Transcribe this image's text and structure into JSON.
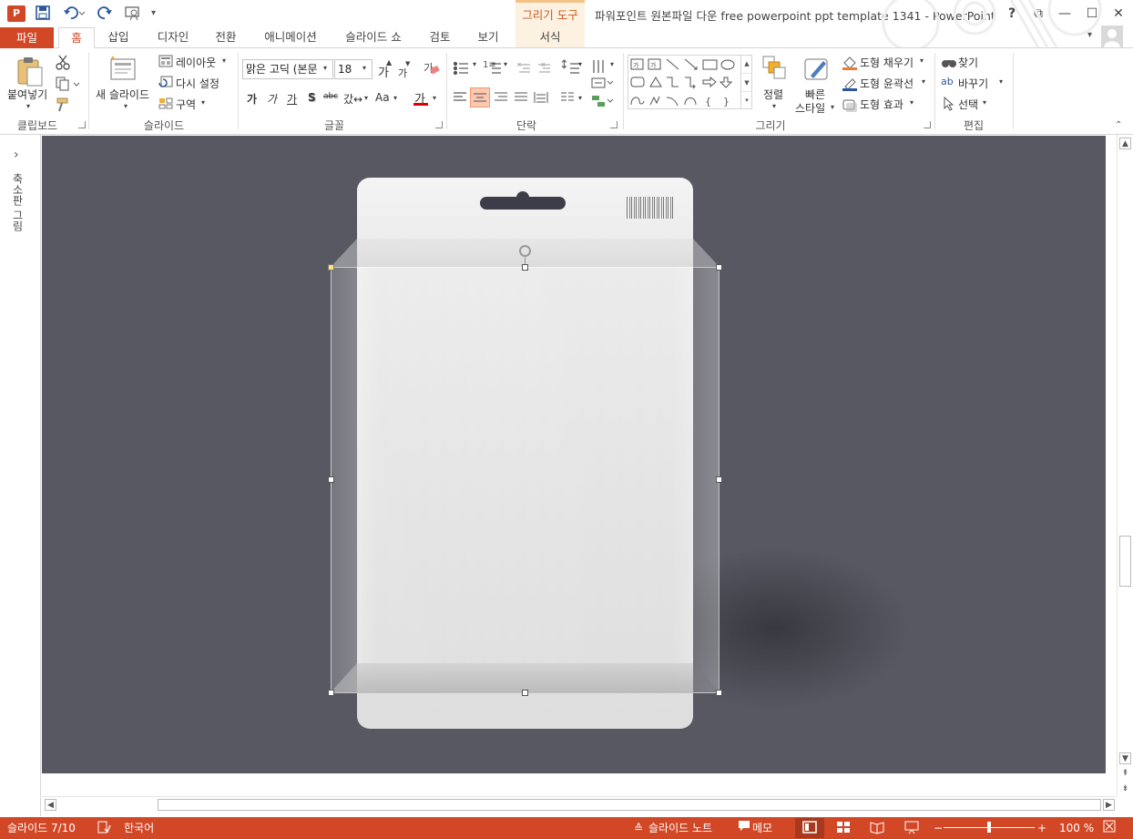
{
  "app": {
    "title": "파워포인트 원본파일 다운 free powerpoint ppt template 1341 - PowerPoint",
    "icon_letter": "P",
    "brand_color": "#d24726"
  },
  "window_controls": {
    "help": "?",
    "restore_ribbon": "⧉",
    "minimize": "—",
    "maximize": "☐",
    "close": "✕"
  },
  "contextual": {
    "label": "그리기 도구"
  },
  "tabs": {
    "file": "파일",
    "home": "홈",
    "insert": "삽입",
    "design": "디자인",
    "transitions": "전환",
    "animations": "애니메이션",
    "slideshow": "슬라이드 쇼",
    "review": "검토",
    "view": "보기",
    "format": "서식"
  },
  "ribbon": {
    "clipboard": {
      "label": "클립보드",
      "paste": "붙여넣기"
    },
    "slides": {
      "label": "슬라이드",
      "new_slide": "새 슬라이드",
      "layout": "레이아웃",
      "reset": "다시 설정",
      "section": "구역"
    },
    "font": {
      "label": "글꼴",
      "font_name": "맑은 고딕 (본문",
      "font_size": "18",
      "grow": "가",
      "shrink": "가",
      "bold": "가",
      "italic": "가",
      "underline": "가",
      "shadow": "S",
      "strike": "abc",
      "spacing": "갔↔",
      "case": "Aa",
      "color": "가"
    },
    "paragraph": {
      "label": "단락"
    },
    "drawing": {
      "label": "그리기",
      "arrange": "정렬",
      "quick_styles": "빠른 스타일",
      "fill": "도형 채우기",
      "outline": "도형 윤곽선",
      "effects": "도형 효과"
    },
    "editing": {
      "label": "편집",
      "find": "찾기",
      "replace": "바꾸기",
      "select": "선택"
    }
  },
  "thumb_pane": {
    "label": "축소판 그림",
    "expand": "›"
  },
  "status": {
    "slide": "슬라이드 7/10",
    "language": "한국어",
    "notes": "슬라이드 노트",
    "comments": "메모",
    "zoom": "100 %",
    "zoom_level": 100
  },
  "colors": {
    "slide_bg": "#585863",
    "status_bar": "#d24726",
    "accent": "#d24726"
  }
}
